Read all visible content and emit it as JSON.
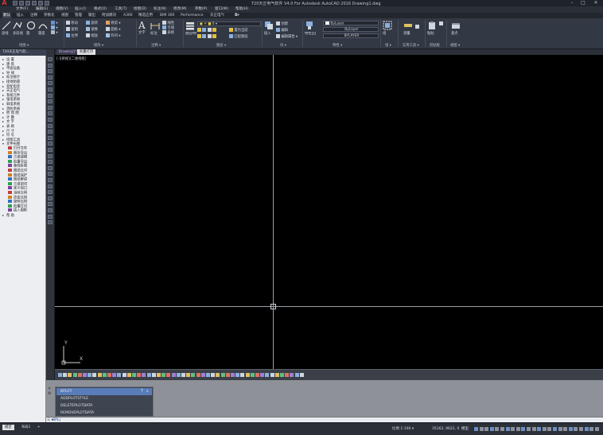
{
  "app": {
    "title": "T20天正电气软件 V4.0 For Autodesk AutoCAD 2016    Drawing1.dwg",
    "logo_glyph": "A",
    "brand_color": "#e03030"
  },
  "window_controls": {
    "minimize": "–",
    "maximize": "□",
    "close": "✕"
  },
  "menus": [
    "文件(F)",
    "编辑(E)",
    "视图(V)",
    "插入(I)",
    "格式(O)",
    "工具(T)",
    "绘图(D)",
    "标注(N)",
    "修改(M)",
    "参数(P)",
    "窗口(W)",
    "帮助(H)"
  ],
  "ribbon_tabs": [
    "默认",
    "插入",
    "注释",
    "参数化",
    "视图",
    "管理",
    "输出",
    "附加模块",
    "A360",
    "精选应用",
    "BIM 360",
    "Performance",
    "天正电气"
  ],
  "ribbon": {
    "draw": {
      "label": "绘图 ▾",
      "buttons": [
        "直线",
        "多段线",
        "圆",
        "圆弧"
      ]
    },
    "modify": {
      "label": "修改 ▾",
      "items": [
        "移动",
        "旋转",
        "修剪",
        "复制",
        "镜像",
        "圆角",
        "拉伸",
        "缩放",
        "阵列"
      ]
    },
    "annotation": {
      "label": "注释 ▾",
      "buttons": [
        "文字",
        "标注"
      ],
      "items": [
        "线性",
        "引线",
        "表格"
      ]
    },
    "layers": {
      "label": "图层 ▾",
      "buttons": [
        "图层特性"
      ],
      "items": [
        "置为当前",
        "匹配图层"
      ]
    },
    "block": {
      "label": "块 ▾",
      "buttons": [
        "插入"
      ],
      "items": [
        "创建",
        "编辑",
        "编辑属性"
      ]
    },
    "properties": {
      "label": "特性 ▾",
      "buttons": [
        "特性匹配"
      ],
      "color": "ByLayer",
      "linetype": "ByLayer",
      "lineweight": "BYLAYER"
    },
    "groups": {
      "label": "组 ▾",
      "buttons": [
        "组"
      ]
    },
    "utilities": {
      "label": "实用工具 ▾",
      "buttons": [
        "测量"
      ]
    },
    "clipboard": {
      "label": "剪贴板",
      "buttons": [
        "粘贴"
      ]
    },
    "view": {
      "label": "视图 ▾",
      "buttons": [
        "基点"
      ]
    }
  },
  "left_panel": {
    "title": "T20天正电气软...",
    "items": [
      {
        "label": "设  置",
        "arrow": "▸"
      },
      {
        "label": "建  筑",
        "arrow": "▸"
      },
      {
        "label": "平面设备",
        "arrow": "▸"
      },
      {
        "label": "导  线",
        "arrow": "▸"
      },
      {
        "label": "标注统计",
        "arrow": "▸"
      },
      {
        "label": "接地防雷",
        "arrow": "▸"
      },
      {
        "label": "变配电室",
        "arrow": "▸"
      },
      {
        "label": "天正电气",
        "arrow": "▸"
      },
      {
        "label": "系统元件",
        "arrow": "▸"
      },
      {
        "label": "强电系统",
        "arrow": "▸"
      },
      {
        "label": "弱电系统",
        "arrow": "▸"
      },
      {
        "label": "消防系统",
        "arrow": "▸"
      },
      {
        "label": "原 理 图",
        "arrow": "▸"
      },
      {
        "label": "计  算",
        "arrow": "▸"
      },
      {
        "label": "文  字",
        "arrow": "▸"
      },
      {
        "label": "表  格",
        "arrow": "▸"
      },
      {
        "label": "尺  寸",
        "arrow": "▸"
      },
      {
        "label": "符  号",
        "arrow": "▸"
      },
      {
        "label": "绘图工具",
        "arrow": "▸"
      },
      {
        "label": "文件布图",
        "arrow": "▾"
      },
      {
        "label": "打开文件",
        "arrow": ""
      },
      {
        "label": "图形导出",
        "arrow": ""
      },
      {
        "label": "三维建模",
        "arrow": ""
      },
      {
        "label": "批量导出",
        "arrow": ""
      },
      {
        "label": "备档拆图",
        "arrow": ""
      },
      {
        "label": "图纸比对",
        "arrow": ""
      },
      {
        "label": "图纸保护",
        "arrow": ""
      },
      {
        "label": "图纸解锁",
        "arrow": ""
      },
      {
        "label": "三维剖切",
        "arrow": ""
      },
      {
        "label": "定义视口",
        "arrow": ""
      },
      {
        "label": "当前比例",
        "arrow": ""
      },
      {
        "label": "改变比例",
        "arrow": ""
      },
      {
        "label": "旋转比例",
        "arrow": ""
      },
      {
        "label": "批量打印",
        "arrow": ""
      },
      {
        "label": "插入图框",
        "arrow": ""
      },
      {
        "label": "帮  助",
        "arrow": "▸"
      }
    ]
  },
  "doc_tabs": [
    "Drawing1*",
    "批量打印"
  ],
  "viewport_label": "[-][俯视][二维线框]",
  "ucs": {
    "x": "X",
    "y": "Y"
  },
  "autocomplete": {
    "items": [
      "BPLOT",
      "ADDPLOTSTYLE",
      "DELETEPLOTDATA",
      "REMOVEPLOTDATA"
    ]
  },
  "command_line": {
    "prompt": "☰ ▾",
    "value": "BPL",
    "cursor": "|"
  },
  "status": {
    "layout_tabs": [
      "模型",
      "布局1",
      "+"
    ],
    "scale": "比例 1:100 ▾",
    "coords": "35162, 9622, 0",
    "mode": "模型"
  },
  "colors": {
    "canvas": "#000000",
    "accent": "#5a7cb8"
  }
}
